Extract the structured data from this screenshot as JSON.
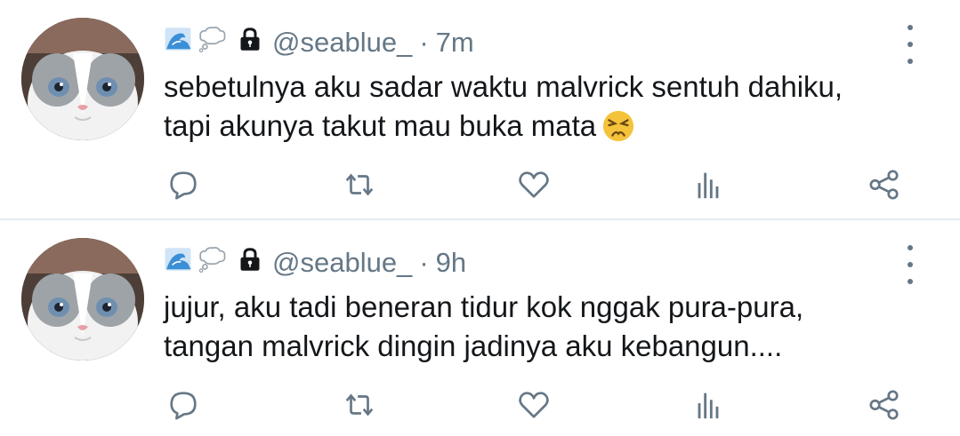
{
  "colors": {
    "text": "#14171a",
    "secondary": "#657786",
    "separator": "#e6ecf0",
    "emoji_face": "#f5c33b"
  },
  "tweets": [
    {
      "name_icons": [
        "water-wave-icon",
        "thought-bubble-icon",
        "lock-icon"
      ],
      "handle": "@seablue_",
      "separator": "·",
      "time": "7m",
      "lines": [
        "sebetulnya aku sadar waktu malvrick sentuh dahiku,",
        "tapi akunya takut mau buka mata"
      ],
      "trailing_emoji": "persevering-face-emoji"
    },
    {
      "name_icons": [
        "water-wave-icon",
        "thought-bubble-icon",
        "lock-icon"
      ],
      "handle": "@seablue_",
      "separator": "·",
      "time": "9h",
      "lines": [
        "jujur, aku tadi beneran tidur kok nggak pura-pura,",
        "tangan malvrick dingin jadinya aku kebangun...."
      ]
    }
  ],
  "actions": [
    "reply-icon",
    "retweet-icon",
    "like-icon",
    "analytics-icon",
    "share-icon"
  ]
}
